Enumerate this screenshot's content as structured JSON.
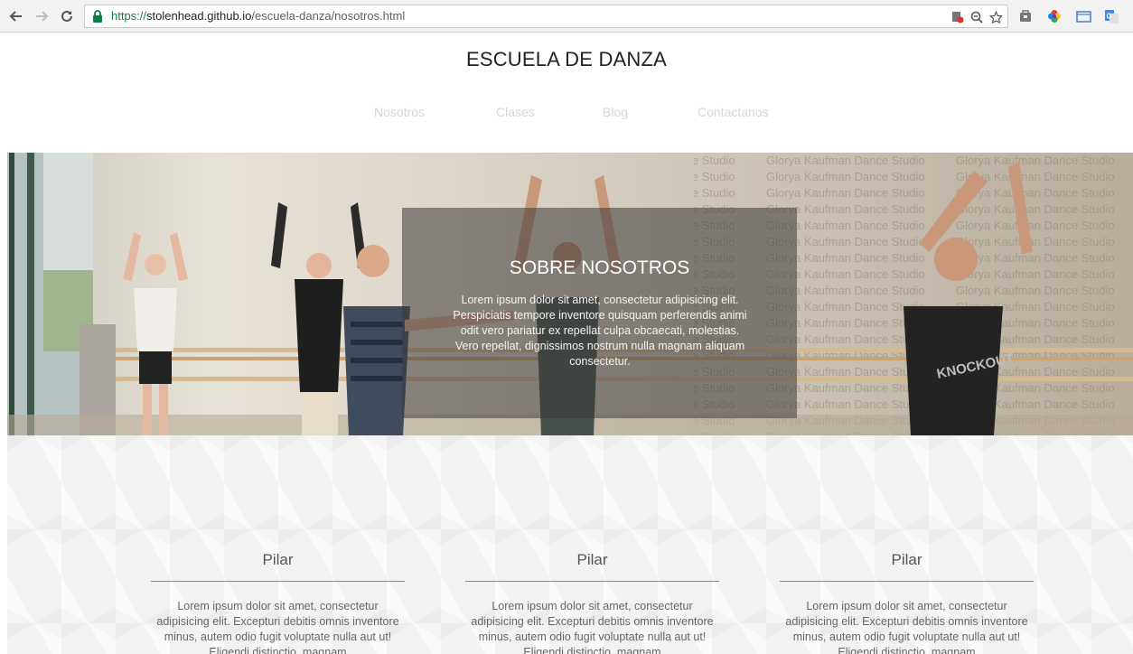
{
  "browser": {
    "url_scheme": "https://",
    "url_host": "stolenhead.github.io",
    "url_path": "/escuela-danza/nosotros.html"
  },
  "site": {
    "title": "ESCUELA DE DANZA",
    "menu": [
      "Nosotros",
      "Clases",
      "Blog",
      "Contactanos"
    ]
  },
  "hero": {
    "title": "SOBRE NOSOTROS",
    "text": "Lorem ipsum dolor sit amet, consectetur adipisicing elit. Perspiciatis tempore inventore quisquam perferendis animi odit vero pariatur ex repellat culpa obcaecati, molestias. Vero repellat, dignissimos nostrum nulla magnam aliquam consectetur.",
    "wall_text": "Glorya Kaufman Dance Studio",
    "shirt_text": "KNOCKOUT"
  },
  "pillars": [
    {
      "title": "Pilar",
      "text": "Lorem ipsum dolor sit amet, consectetur adipisicing elit. Excepturi debitis omnis inventore minus, autem odio fugit voluptate nulla aut ut! Eligendi distinctio, magnam"
    },
    {
      "title": "Pilar",
      "text": "Lorem ipsum dolor sit amet, consectetur adipisicing elit. Excepturi debitis omnis inventore minus, autem odio fugit voluptate nulla aut ut! Eligendi distinctio, magnam"
    },
    {
      "title": "Pilar",
      "text": "Lorem ipsum dolor sit amet, consectetur adipisicing elit. Excepturi debitis omnis inventore minus, autem odio fugit voluptate nulla aut ut! Eligendi distinctio, magnam"
    }
  ],
  "colors": {
    "chrome_bg": "#f2f2f2",
    "secure_green": "#0b8043",
    "menu_text": "#d6d6d6",
    "section_bg": "#f2f2f2"
  }
}
